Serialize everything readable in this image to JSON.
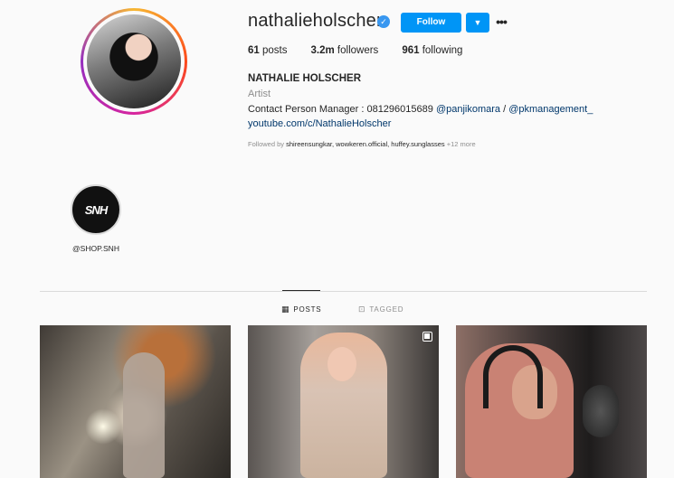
{
  "profile": {
    "username": "nathalieholscher",
    "follow_label": "Follow",
    "more_label": "•••",
    "stats": {
      "posts_count": "61",
      "posts_label": "posts",
      "followers_count": "3.2m",
      "followers_label": "followers",
      "following_count": "961",
      "following_label": "following"
    },
    "full_name": "NATHALIE HOLSCHER",
    "category": "Artist",
    "bio_prefix": "Contact Person Manager : 081296015689 ",
    "bio_mention1": "@panjikomara",
    "bio_sep": " / ",
    "bio_mention2": "@pkmanagement_",
    "link": "youtube.com/c/NathalieHolscher",
    "followed_by_prefix": "Followed by ",
    "followed_by_users": "shireensungkar, wowkeren.official, huffey.sunglasses",
    "followed_by_more": " +12 more"
  },
  "highlight": {
    "logo_text": "SNH",
    "label": "@SHOP.SNH"
  },
  "tabs": {
    "posts": "POSTS",
    "tagged": "TAGGED"
  },
  "colors": {
    "accent": "#0095f6",
    "link": "#00376b",
    "muted": "#8e8e8e"
  }
}
